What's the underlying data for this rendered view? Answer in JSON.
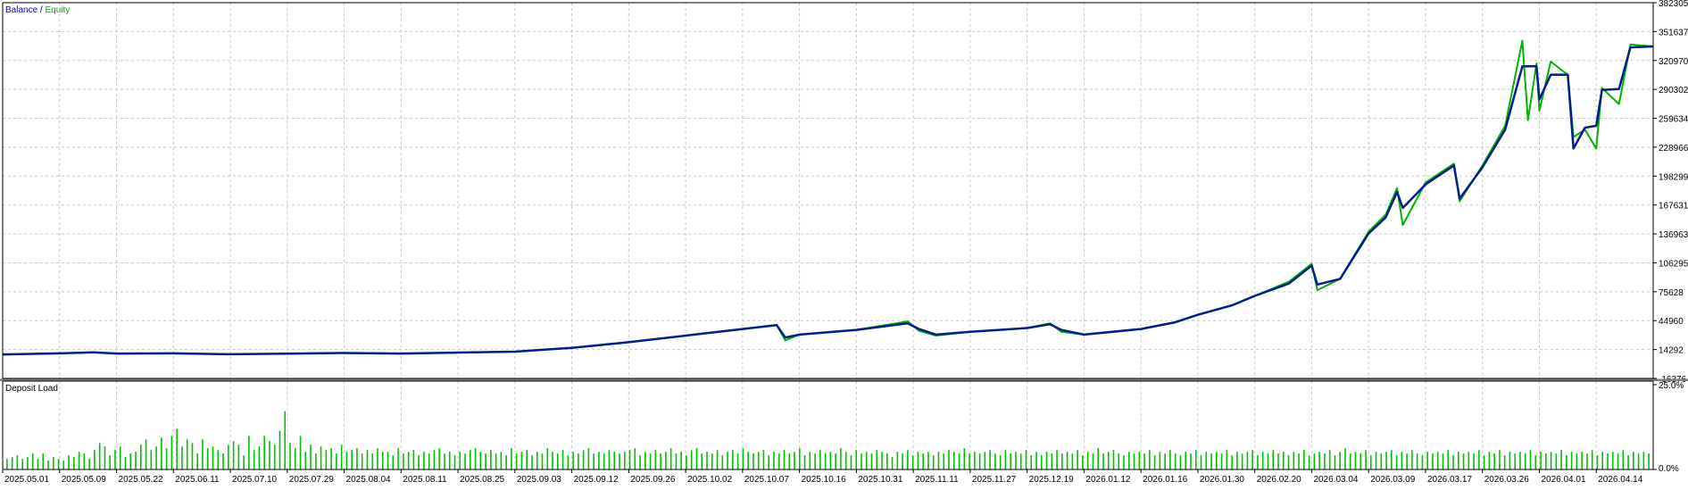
{
  "colors": {
    "balance": "#0000ff",
    "balance_line": "#001e8c",
    "equity": "#00b400",
    "deposit_load": "#00c000",
    "grid": "#c8c8c8",
    "frame": "#000000",
    "separator": "#808080",
    "label": "#000000"
  },
  "chart_data": [
    {
      "type": "line",
      "legend": {
        "balance_label": "Balance",
        "separator": " / ",
        "equity_label": "Equity",
        "placement": "top-left"
      },
      "grid": true,
      "ylim": [
        -15376,
        382305
      ],
      "y_ticks": [
        "382305",
        "351637",
        "320970",
        "290302",
        "259634",
        "228966",
        "198299",
        "167631",
        "136963",
        "106295",
        "75628",
        "44960",
        "14292",
        "-16376"
      ],
      "x_range": [
        0,
        29
      ],
      "series": [
        {
          "name": "Balance",
          "points": [
            [
              0,
              10000
            ],
            [
              1,
              11200
            ],
            [
              1.6,
              12300
            ],
            [
              2,
              11000
            ],
            [
              3,
              11200
            ],
            [
              4,
              10200
            ],
            [
              5,
              10900
            ],
            [
              6,
              11500
            ],
            [
              7,
              11000
            ],
            [
              8,
              12000
            ],
            [
              9,
              13000
            ],
            [
              10,
              17000
            ],
            [
              11,
              23000
            ],
            [
              12,
              30000
            ],
            [
              13,
              37000
            ],
            [
              13.6,
              41000
            ],
            [
              13.75,
              28000
            ],
            [
              14,
              31000
            ],
            [
              15,
              36000
            ],
            [
              15.9,
              43000
            ],
            [
              16.1,
              37000
            ],
            [
              16.4,
              31000
            ],
            [
              17,
              34000
            ],
            [
              18,
              38000
            ],
            [
              18.4,
              42000
            ],
            [
              18.6,
              36000
            ],
            [
              19,
              31000
            ],
            [
              20,
              37000
            ],
            [
              20.6,
              44000
            ],
            [
              21,
              52000
            ],
            [
              21.6,
              62000
            ],
            [
              22,
              72000
            ],
            [
              22.6,
              85000
            ],
            [
              23,
              104000
            ],
            [
              23.1,
              84000
            ],
            [
              23.5,
              90000
            ],
            [
              24,
              138000
            ],
            [
              24.3,
              155000
            ],
            [
              24.5,
              182000
            ],
            [
              24.6,
              165000
            ],
            [
              25,
              190000
            ],
            [
              25.5,
              210000
            ],
            [
              25.6,
              175000
            ],
            [
              26,
              208000
            ],
            [
              26.4,
              248000
            ],
            [
              26.7,
              315000
            ],
            [
              26.95,
              315000
            ],
            [
              27,
              280000
            ],
            [
              27.2,
              306000
            ],
            [
              27.5,
              306000
            ],
            [
              27.6,
              228000
            ],
            [
              27.8,
              250000
            ],
            [
              28,
              252000
            ],
            [
              28.1,
              290000
            ],
            [
              28.4,
              291000
            ],
            [
              28.6,
              335000
            ],
            [
              29,
              336000
            ]
          ]
        },
        {
          "name": "Equity",
          "points": [
            [
              0,
              10000
            ],
            [
              1,
              11200
            ],
            [
              1.6,
              12300
            ],
            [
              2,
              11000
            ],
            [
              3,
              11200
            ],
            [
              4,
              10200
            ],
            [
              5,
              10900
            ],
            [
              6,
              11500
            ],
            [
              7,
              11000
            ],
            [
              8,
              12000
            ],
            [
              9,
              13000
            ],
            [
              10,
              17000
            ],
            [
              11,
              23000
            ],
            [
              12,
              30000
            ],
            [
              13,
              37000
            ],
            [
              13.6,
              41000
            ],
            [
              13.75,
              25000
            ],
            [
              14,
              31000
            ],
            [
              15,
              36000
            ],
            [
              15.9,
              45000
            ],
            [
              16.1,
              35000
            ],
            [
              16.4,
              30000
            ],
            [
              17,
              34000
            ],
            [
              18,
              38000
            ],
            [
              18.4,
              43000
            ],
            [
              18.6,
              34000
            ],
            [
              19,
              31000
            ],
            [
              20,
              37000
            ],
            [
              20.6,
              44000
            ],
            [
              21,
              52000
            ],
            [
              21.6,
              62000
            ],
            [
              22,
              72000
            ],
            [
              22.6,
              87000
            ],
            [
              23,
              106000
            ],
            [
              23.1,
              78000
            ],
            [
              23.5,
              90000
            ],
            [
              24,
              140000
            ],
            [
              24.3,
              158000
            ],
            [
              24.5,
              186000
            ],
            [
              24.6,
              147000
            ],
            [
              25,
              192000
            ],
            [
              25.5,
              212000
            ],
            [
              25.6,
              172000
            ],
            [
              26,
              210000
            ],
            [
              26.4,
              252000
            ],
            [
              26.7,
              342000
            ],
            [
              26.8,
              258000
            ],
            [
              26.95,
              318000
            ],
            [
              27,
              268000
            ],
            [
              27.2,
              320000
            ],
            [
              27.5,
              306000
            ],
            [
              27.6,
              240000
            ],
            [
              27.8,
              248000
            ],
            [
              28,
              228000
            ],
            [
              28.1,
              292000
            ],
            [
              28.4,
              275000
            ],
            [
              28.6,
              338000
            ],
            [
              29,
              336000
            ]
          ]
        }
      ]
    },
    {
      "type": "bar",
      "title": "Deposit Load",
      "ylim": [
        0,
        25
      ],
      "y_ticks": [
        "25.0%",
        "0.0%"
      ],
      "x_labels": [
        "2025.05.01",
        "2025.05.09",
        "2025.05.22",
        "2025.06.11",
        "2025.07.10",
        "2025.07.29",
        "2025.08.04",
        "2025.08.11",
        "2025.08.25",
        "2025.09.03",
        "2025.09.12",
        "2025.09.26",
        "2025.10.02",
        "2025.10.07",
        "2025.10.16",
        "2025.10.31",
        "2025.11.11",
        "2025.11.27",
        "2025.12.19",
        "2026.01.12",
        "2026.01.16",
        "2026.01.30",
        "2026.02.20",
        "2026.03.04",
        "2026.03.09",
        "2026.03.17",
        "2026.03.26",
        "2026.04.01",
        "2026.04.14"
      ],
      "values": [
        3.0,
        3.5,
        4.0,
        3.0,
        3.5,
        4.5,
        3.0,
        4.5,
        2.5,
        3.5,
        3.0,
        2.5,
        4.0,
        3.5,
        5.0,
        4.5,
        3.0,
        5.5,
        7.5,
        6.5,
        4.0,
        5.5,
        6.5,
        3.5,
        4.5,
        5.0,
        7.0,
        8.5,
        5.5,
        6.5,
        9.0,
        6.0,
        9.5,
        11.5,
        6.5,
        8.5,
        7.5,
        4.5,
        8.5,
        6.0,
        6.5,
        5.5,
        4.5,
        7.0,
        8.0,
        7.0,
        4.0,
        9.5,
        5.5,
        6.5,
        9.5,
        8.0,
        7.0,
        11.0,
        16.5,
        7.5,
        6.0,
        9.5,
        5.0,
        7.0,
        4.5,
        6.5,
        5.5,
        6.0,
        4.5,
        7.0,
        5.0,
        5.5,
        6.0,
        4.5,
        5.5,
        4.5,
        6.0,
        5.0,
        5.0,
        4.0,
        6.0,
        4.5,
        5.0,
        5.5,
        4.0,
        5.0,
        4.5,
        5.5,
        6.0,
        4.5,
        5.0,
        4.0,
        5.0,
        4.5,
        5.5,
        6.0,
        5.0,
        4.5,
        5.5,
        4.5,
        5.0,
        4.0,
        6.0,
        4.5,
        5.0,
        5.5,
        4.0,
        5.0,
        4.5,
        6.0,
        5.0,
        4.5,
        5.5,
        4.0,
        5.0,
        4.5,
        5.5,
        6.0,
        4.5,
        5.0,
        4.5,
        5.5,
        5.0,
        4.5,
        5.0,
        5.5,
        6.0,
        4.0,
        5.0,
        4.5,
        5.5,
        4.5,
        5.0,
        6.0,
        4.5,
        5.0,
        4.0,
        5.5,
        6.0,
        4.5,
        5.0,
        4.5,
        5.5,
        4.0,
        5.0,
        5.5,
        4.5,
        6.0,
        5.0,
        4.5,
        5.0,
        5.5,
        4.0,
        5.0,
        4.5,
        5.5,
        4.5,
        5.0,
        6.0,
        4.0,
        5.0,
        4.5,
        5.5,
        4.5,
        5.0,
        4.5,
        6.0,
        5.0,
        4.0,
        5.5,
        4.5,
        5.0,
        4.5,
        5.5,
        5.0,
        4.5,
        3.5,
        5.0,
        4.5,
        5.5,
        4.0,
        5.0,
        4.5,
        5.0,
        4.0,
        5.0,
        4.5,
        5.5,
        5.0,
        4.5,
        6.0,
        4.5,
        5.0,
        4.5,
        5.0,
        5.5,
        4.5,
        4.0,
        5.5,
        4.5,
        5.0,
        4.5,
        5.5,
        4.0,
        5.0,
        4.0,
        5.0,
        4.5,
        5.5,
        4.5,
        5.0,
        4.5,
        5.5,
        4.0,
        5.0,
        4.5,
        6.0,
        4.5,
        5.0,
        5.5,
        4.5,
        4.0,
        5.0,
        4.5,
        5.0,
        4.5,
        5.5,
        4.0,
        5.0,
        4.5,
        5.5,
        4.5,
        4.0,
        5.0,
        4.5,
        5.5,
        4.0,
        5.0,
        4.5,
        5.0,
        4.5,
        5.5,
        4.0,
        5.0,
        4.5,
        5.0,
        5.5,
        4.0,
        5.0,
        4.5,
        5.5,
        4.5,
        5.0,
        4.0,
        5.0,
        4.5,
        5.5,
        4.0,
        4.5,
        5.0,
        4.5,
        5.5,
        4.0,
        5.0,
        6.0,
        4.5,
        5.0,
        4.5,
        5.5,
        4.0,
        5.0,
        4.5,
        5.0,
        5.5,
        4.0,
        5.0,
        4.5,
        5.5,
        4.5,
        4.0,
        5.0,
        4.5,
        5.0,
        4.5,
        5.5,
        4.0,
        5.0,
        4.5,
        5.0,
        4.5,
        5.5,
        4.0,
        5.0,
        4.5,
        5.5,
        4.0,
        5.0,
        4.5,
        5.0,
        4.5,
        5.5,
        4.0,
        5.0,
        4.5,
        5.0,
        4.5,
        5.5,
        4.0,
        5.0,
        4.5,
        5.0,
        4.5,
        5.5,
        4.0,
        5.0,
        4.5,
        5.0,
        4.5,
        5.5,
        4.0,
        5.0,
        4.5,
        5.0,
        4.5
      ]
    }
  ]
}
